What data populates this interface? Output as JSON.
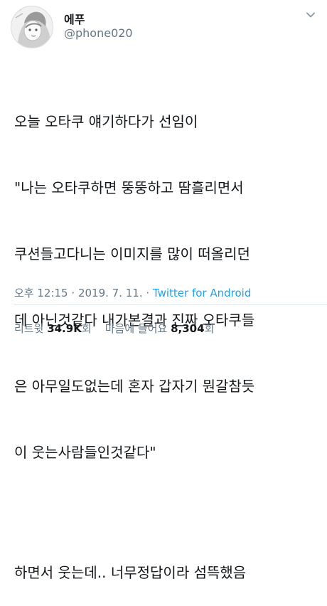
{
  "tweet": {
    "display_name": "에푸",
    "handle": "@phone020",
    "text_lines": [
      "오늘 오타쿠 얘기하다가 선임이",
      "\"나는 오타쿠하면 뚱뚱하고 땀흘리면서",
      "쿠션들고다니는 이미지를 많이 떠올리던",
      "데 아닌것같다 내가본결과 진짜 오타쿠들",
      "은 아무일도없는데 혼자 갑자기 뭔갈참듯",
      "이 웃는사람들인것같다\"",
      "하면서 웃는데.. 너무정답이라 섬뜩했음"
    ],
    "time": "오후 12:15",
    "date": "2019. 7. 11.",
    "source": "Twitter for Android",
    "retweets_label": "리트윗",
    "retweets_count": "34.9K",
    "retweets_unit": "회",
    "likes_label": "마음에 들어요",
    "likes_count": "8,304",
    "likes_unit": "회"
  },
  "icons": {
    "menu": "chevron-down-icon",
    "avatar": "avatar"
  },
  "colors": {
    "text": "#14171a",
    "secondary": "#657786",
    "link": "#1da1f2",
    "divider": "#e1e8ed"
  }
}
